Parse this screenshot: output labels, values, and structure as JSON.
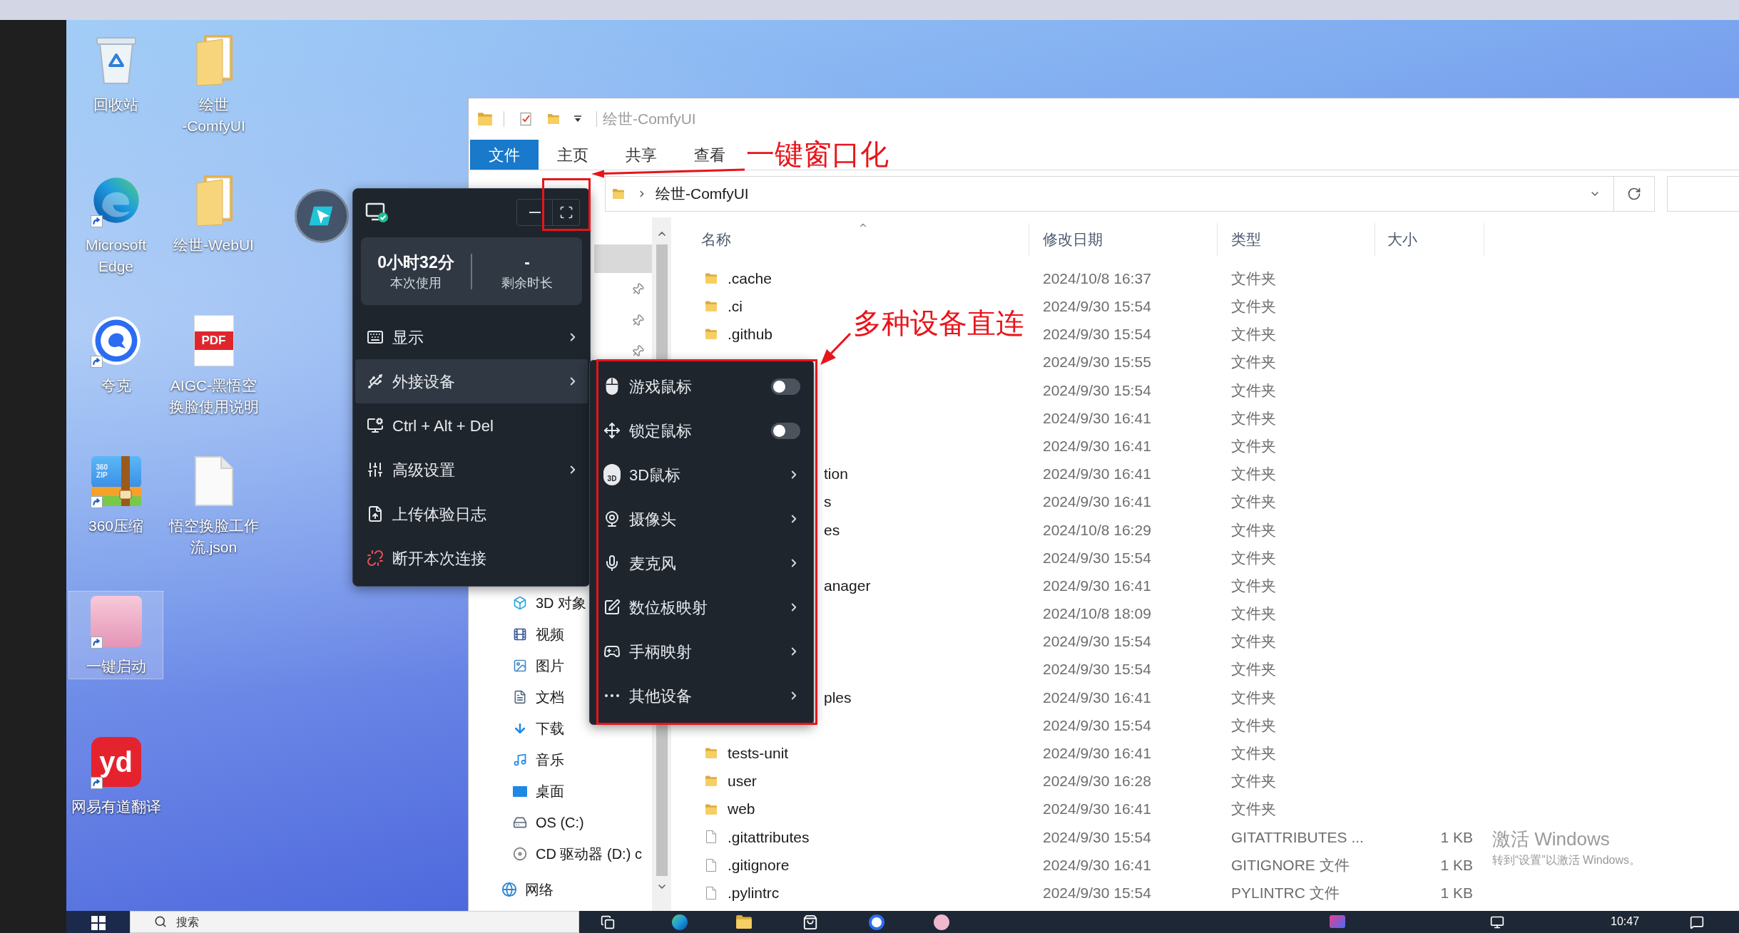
{
  "desktop": {
    "icons": [
      {
        "kind": "recycle_bin",
        "label": "回收站",
        "shortcut": false,
        "selected": false
      },
      {
        "kind": "edge",
        "label": "Microsoft\nEdge",
        "shortcut": true,
        "selected": false
      },
      {
        "kind": "quark",
        "label": "夸克",
        "shortcut": true,
        "selected": false
      },
      {
        "kind": "zip",
        "label": "360压缩",
        "badge": "360\nZIP",
        "shortcut": true,
        "selected": false
      },
      {
        "kind": "avatar",
        "label": "一键启动",
        "shortcut": true,
        "selected": true
      },
      {
        "kind": "youdao",
        "label": "网易有道翻译",
        "badge": "yd",
        "shortcut": true,
        "selected": false
      },
      {
        "kind": "folder",
        "label": "绘世\n-ComfyUI",
        "shortcut": false,
        "selected": false
      },
      {
        "kind": "folder",
        "label": "绘世-WebUI",
        "shortcut": false,
        "selected": false
      },
      {
        "kind": "pdf",
        "label": "AIGC-黑悟空换脸使用说明",
        "badge": "PDF",
        "shortcut": false,
        "selected": false
      },
      {
        "kind": "file",
        "label": "悟空换脸工作流.json",
        "shortcut": false,
        "selected": false
      }
    ]
  },
  "remote_panel": {
    "stats": [
      {
        "value": "0小时32分",
        "label": "本次使用"
      },
      {
        "value": "-",
        "label": "剩余时长"
      }
    ],
    "menu": [
      {
        "label": "显示",
        "has_submenu": true,
        "selected": false
      },
      {
        "label": "外接设备",
        "has_submenu": true,
        "selected": true
      },
      {
        "label": "Ctrl + Alt + Del",
        "has_submenu": false,
        "selected": false
      },
      {
        "label": "高级设置",
        "has_submenu": true,
        "selected": false
      },
      {
        "label": "上传体验日志",
        "has_submenu": false,
        "selected": false
      },
      {
        "label": "断开本次连接",
        "has_submenu": false,
        "selected": false
      }
    ]
  },
  "device_menu": {
    "items": [
      {
        "kind": "toggle",
        "label": "游戏鼠标",
        "on": false
      },
      {
        "kind": "toggle",
        "label": "锁定鼠标",
        "on": false
      },
      {
        "kind": "submenu",
        "label": "3D鼠标",
        "icon_text": "3D"
      },
      {
        "kind": "submenu",
        "label": "摄像头"
      },
      {
        "kind": "submenu",
        "label": "麦克风"
      },
      {
        "kind": "submenu",
        "label": "数位板映射"
      },
      {
        "kind": "submenu",
        "label": "手柄映射"
      },
      {
        "kind": "submenu",
        "label": "其他设备"
      }
    ]
  },
  "explorer": {
    "title": "绘世-ComfyUI",
    "ribbon_tabs": [
      {
        "label": "文件",
        "selected": true
      },
      {
        "label": "主页",
        "selected": false
      },
      {
        "label": "共享",
        "selected": false
      },
      {
        "label": "查看",
        "selected": false
      }
    ],
    "address_path": "绘世-ComfyUI",
    "nav_pane": {
      "quick_access": [
        {
          "selected": true,
          "pinned": false
        },
        {
          "selected": false,
          "pinned": true
        },
        {
          "selected": false,
          "pinned": true
        },
        {
          "selected": false,
          "pinned": true
        }
      ],
      "pc_items": [
        {
          "label": "3D 对象"
        },
        {
          "label": "视频"
        },
        {
          "label": "图片"
        },
        {
          "label": "文档"
        },
        {
          "label": "下载"
        },
        {
          "label": "音乐"
        },
        {
          "label": "桌面"
        },
        {
          "label": "OS (C:)"
        },
        {
          "label": "CD 驱动器 (D:) c"
        }
      ],
      "network": {
        "label": "网络"
      }
    },
    "columns": [
      {
        "label": "名称",
        "sorted": true
      },
      {
        "label": "修改日期",
        "sorted": false
      },
      {
        "label": "类型",
        "sorted": false
      },
      {
        "label": "大小",
        "sorted": false
      }
    ],
    "rows": [
      {
        "kind": "folder",
        "name": ".cache",
        "date": "2024/10/8 16:37",
        "type": "文件夹"
      },
      {
        "kind": "folder",
        "name": ".ci",
        "date": "2024/9/30 15:54",
        "type": "文件夹"
      },
      {
        "kind": "folder",
        "name": ".github",
        "date": "2024/9/30 15:54",
        "type": "文件夹"
      },
      {
        "date": "2024/9/30 15:55",
        "type": "文件夹"
      },
      {
        "date": "2024/9/30 15:54",
        "type": "文件夹"
      },
      {
        "date": "2024/9/30 16:41",
        "type": "文件夹"
      },
      {
        "date": "2024/9/30 16:41",
        "type": "文件夹"
      },
      {
        "name_tail": "tion",
        "date": "2024/9/30 16:41",
        "type": "文件夹"
      },
      {
        "name_tail": "s",
        "date": "2024/9/30 16:41",
        "type": "文件夹"
      },
      {
        "name_tail": "es",
        "date": "2024/10/8 16:29",
        "type": "文件夹"
      },
      {
        "date": "2024/9/30 15:54",
        "type": "文件夹"
      },
      {
        "name_tail": "anager",
        "date": "2024/9/30 16:41",
        "type": "文件夹"
      },
      {
        "date": "2024/10/8 18:09",
        "type": "文件夹"
      },
      {
        "date": "2024/9/30 15:54",
        "type": "文件夹"
      },
      {
        "date": "2024/9/30 15:54",
        "type": "文件夹"
      },
      {
        "name_tail": "ples",
        "date": "2024/9/30 16:41",
        "type": "文件夹"
      },
      {
        "date": "2024/9/30 15:54",
        "type": "文件夹"
      },
      {
        "kind": "folder",
        "name": "tests-unit",
        "date": "2024/9/30 16:41",
        "type": "文件夹"
      },
      {
        "kind": "folder",
        "name": "user",
        "date": "2024/9/30 16:28",
        "type": "文件夹"
      },
      {
        "kind": "folder",
        "name": "web",
        "date": "2024/9/30 16:41",
        "type": "文件夹"
      },
      {
        "kind": "file",
        "name": ".gitattributes",
        "date": "2024/9/30 15:54",
        "type": "GITATTRIBUTES ...",
        "size": "1 KB"
      },
      {
        "kind": "file",
        "name": ".gitignore",
        "date": "2024/9/30 16:41",
        "type": "GITIGNORE 文件",
        "size": "1 KB"
      },
      {
        "kind": "file",
        "name": ".pylintrc",
        "date": "2024/9/30 15:54",
        "type": "PYLINTRC 文件",
        "size": "1 KB"
      }
    ]
  },
  "annotations": [
    {
      "text": "一键窗口化"
    },
    {
      "text": "多种设备直连"
    }
  ],
  "activation_notice": {
    "title": "激活 Windows",
    "hint": "转到“设置”以激活 Windows。"
  },
  "taskbar": {
    "search_placeholder": "搜索",
    "clock": "10:47"
  }
}
